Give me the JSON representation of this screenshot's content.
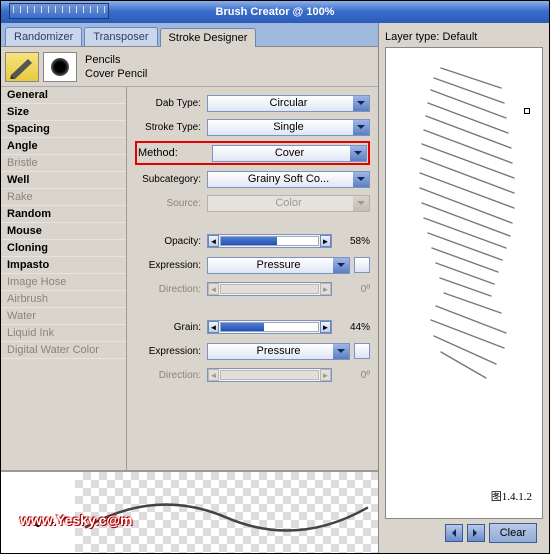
{
  "window": {
    "title": "Brush Creator @ 100%"
  },
  "tabs": {
    "randomizer": "Randomizer",
    "transposer": "Transposer",
    "stroke_designer": "Stroke Designer"
  },
  "tool": {
    "category": "Pencils",
    "variant": "Cover Pencil"
  },
  "categories": [
    {
      "label": "General",
      "b": true
    },
    {
      "label": "Size",
      "b": true
    },
    {
      "label": "Spacing",
      "b": true
    },
    {
      "label": "Angle",
      "b": true
    },
    {
      "label": "Bristle",
      "b": false
    },
    {
      "label": "Well",
      "b": true
    },
    {
      "label": "Rake",
      "b": false
    },
    {
      "label": "Random",
      "b": true
    },
    {
      "label": "Mouse",
      "b": true
    },
    {
      "label": "Cloning",
      "b": true
    },
    {
      "label": "Impasto",
      "b": true
    },
    {
      "label": "Image Hose",
      "b": false
    },
    {
      "label": "Airbrush",
      "b": false
    },
    {
      "label": "Water",
      "b": false
    },
    {
      "label": "Liquid Ink",
      "b": false
    },
    {
      "label": "Digital Water Color",
      "b": false
    }
  ],
  "settings": {
    "dab_type": {
      "label": "Dab Type:",
      "value": "Circular"
    },
    "stroke_type": {
      "label": "Stroke Type:",
      "value": "Single"
    },
    "method": {
      "label": "Method:",
      "value": "Cover"
    },
    "subcategory": {
      "label": "Subcategory:",
      "value": "Grainy Soft Co..."
    },
    "source": {
      "label": "Source:",
      "value": "Color",
      "disabled": true
    },
    "opacity": {
      "label": "Opacity:",
      "value": "58%",
      "fill": 58
    },
    "expression1": {
      "label": "Expression:",
      "value": "Pressure"
    },
    "direction1": {
      "label": "Direction:",
      "value": "0º",
      "disabled": true
    },
    "grain": {
      "label": "Grain:",
      "value": "44%",
      "fill": 44
    },
    "expression2": {
      "label": "Expression:",
      "value": "Pressure"
    },
    "direction2": {
      "label": "Direction:",
      "value": "0º",
      "disabled": true
    }
  },
  "right": {
    "layer_type": "Layer type: Default",
    "figure_label": "图1.4.1.2",
    "clear": "Clear"
  },
  "watermark": "www.Yesky.c@m"
}
